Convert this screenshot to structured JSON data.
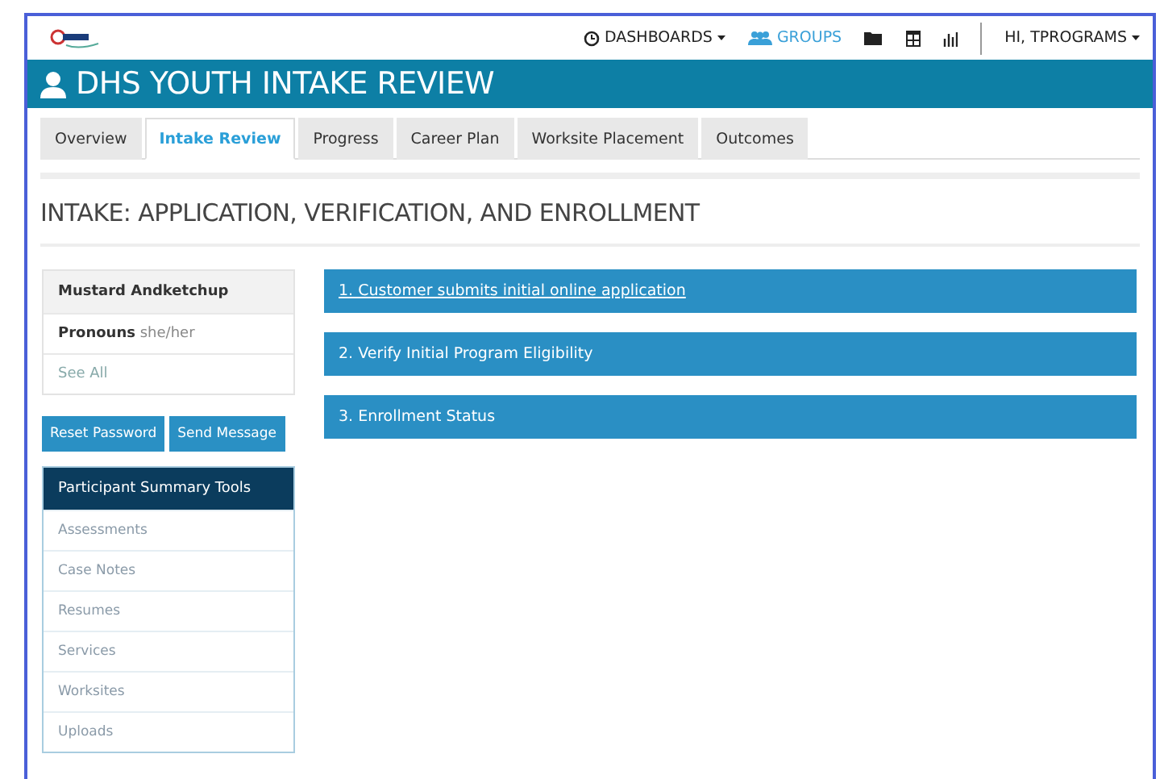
{
  "nav": [
    {
      "kind": "clock",
      "label": "DASHBOARDS",
      "caret": true,
      "selected": false
    },
    {
      "kind": "users",
      "label": "GROUPS",
      "caret": false,
      "selected": true
    },
    {
      "kind": "folder",
      "selected": false
    },
    {
      "kind": "table",
      "selected": false
    },
    {
      "kind": "bars",
      "selected": false
    }
  ],
  "user_menu": {
    "label": "HI, TPROGRAMS",
    "caret": true
  },
  "page_title": "DHS YOUTH INTAKE REVIEW",
  "tabs": [
    {
      "label": "Overview",
      "selected": false
    },
    {
      "label": "Intake Review",
      "selected": true
    },
    {
      "label": "Progress",
      "selected": false
    },
    {
      "label": "Career Plan",
      "selected": false
    },
    {
      "label": "Worksite Placement",
      "selected": false
    },
    {
      "label": "Outcomes",
      "selected": false
    }
  ],
  "section_heading": "INTAKE: APPLICATION, VERIFICATION, AND ENROLLMENT",
  "participant": {
    "name": "Mustard Andketchup",
    "pronouns_label": "Pronouns",
    "pronouns": "she/her",
    "see_all": "See All"
  },
  "buttons": [
    "Reset Password",
    "Send Message"
  ],
  "tools": {
    "title": "Participant Summary Tools",
    "items": [
      "Assessments",
      "Case Notes",
      "Resumes",
      "Services",
      "Worksites",
      "Uploads"
    ]
  },
  "steps": [
    {
      "label": "1. Customer submits initial online application",
      "underlined": true
    },
    {
      "label": "2. Verify Initial Program Eligibility",
      "underlined": false
    },
    {
      "label": "3. Enrollment Status",
      "underlined": false
    }
  ]
}
